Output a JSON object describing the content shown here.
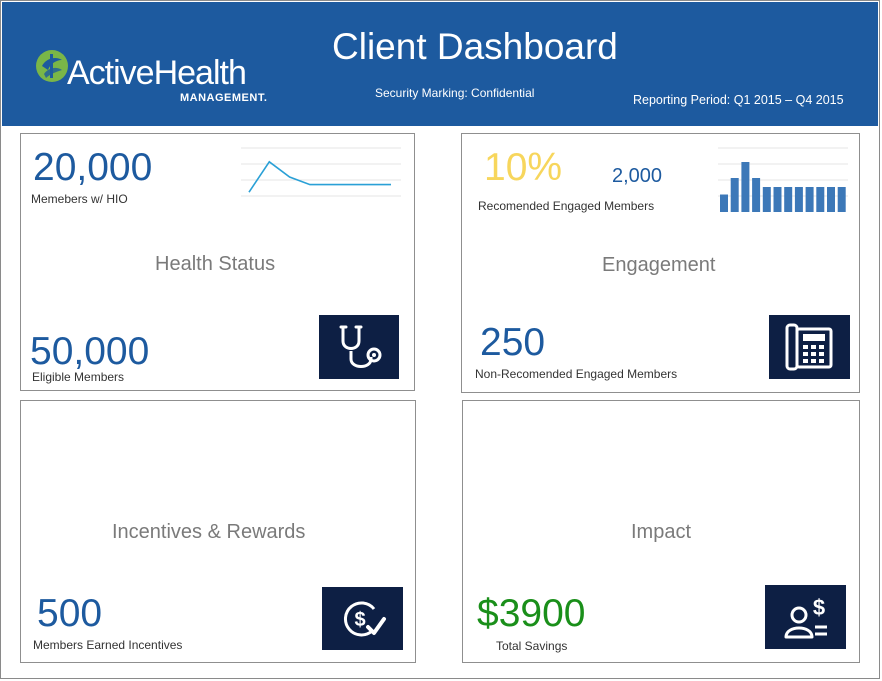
{
  "header": {
    "title": "Client Dashboard",
    "security_marking": "Security Marking: Confidential",
    "reporting_period": "Reporting Period: Q1 2015 – Q4 2015",
    "logo_main": "ActiveHealth",
    "logo_sub": "MANAGEMENT.",
    "logo_icon": "leaf-emblem-icon"
  },
  "colors": {
    "header_bg": "#1d5a9f",
    "value_blue": "#1d5a9f",
    "icon_box": "#0d1f44",
    "yellow": "#f7d65c",
    "green": "#1a8f1a",
    "logo_green": "#7ab648"
  },
  "panels": {
    "health_status": {
      "title": "Health Status",
      "metric_top_value": "20,000",
      "metric_top_label": "Memebers w/ HIO",
      "metric_bottom_value": "50,000",
      "metric_bottom_label": "Eligible Members",
      "icon": "stethoscope-icon",
      "sparkline": [
        0.1,
        0.9,
        0.5,
        0.3,
        0.3,
        0.3,
        0.3,
        0.3
      ]
    },
    "engagement": {
      "title": "Engagement",
      "metric_top_value": "10%",
      "metric_top_secondary": "2,000",
      "metric_top_label": "Recomended Engaged Members",
      "metric_bottom_value": "250",
      "metric_bottom_label": "Non-Recomended Engaged Members",
      "icon": "phone-icon",
      "mini_bars": [
        0.35,
        0.68,
        1.0,
        0.68,
        0.5,
        0.5,
        0.5,
        0.5,
        0.5,
        0.5,
        0.5,
        0.5
      ]
    },
    "incentives": {
      "title": "Incentives  & Rewards",
      "metric_bottom_value": "500",
      "metric_bottom_label": "Members Earned Incentives",
      "icon": "dollar-check-icon"
    },
    "impact": {
      "title": "Impact",
      "metric_bottom_value": "$3900",
      "metric_bottom_label": "Total Savings",
      "icon": "person-dollar-icon"
    }
  }
}
